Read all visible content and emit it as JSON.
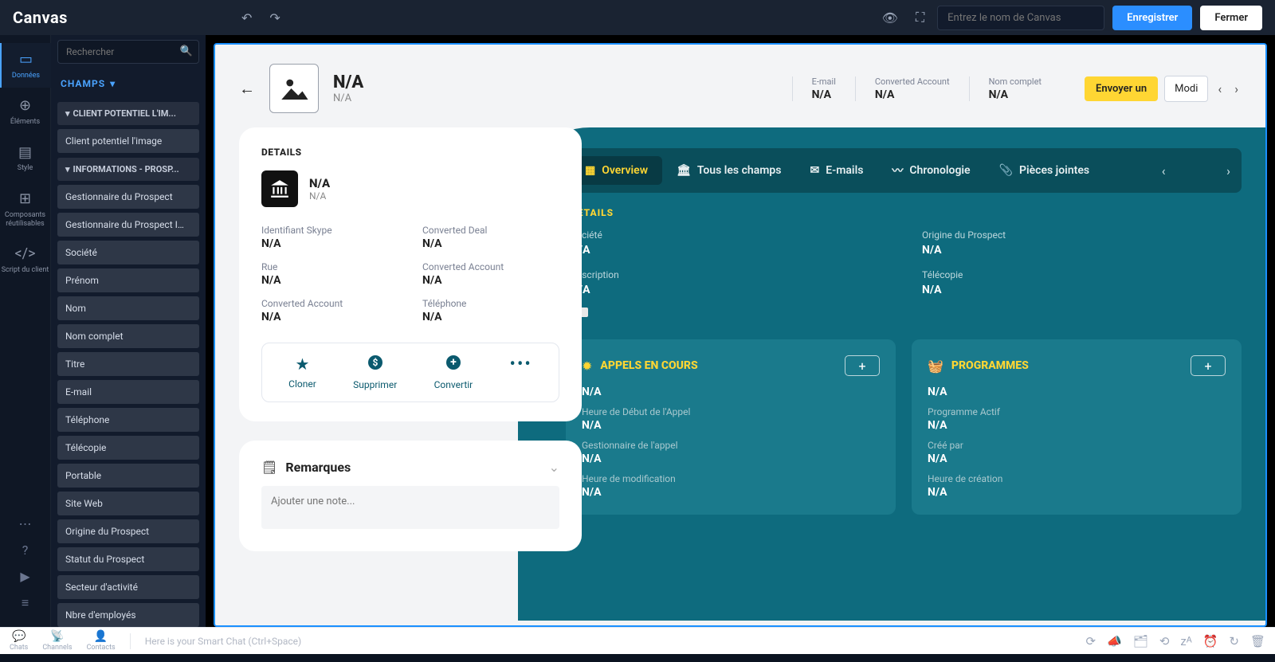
{
  "topbar": {
    "logo": "Canvas",
    "canvas_name_placeholder": "Entrez le nom de Canvas",
    "save": "Enregistrer",
    "close": "Fermer"
  },
  "rail": {
    "data": "Données",
    "elements": "Éléments",
    "style": "Style",
    "reusable": "Composants réutilisables",
    "script": "Script du client"
  },
  "sidebar": {
    "search_placeholder": "Rechercher",
    "panel_title": "CHAMPS",
    "group1": "CLIENT POTENTIEL L'IM...",
    "group1_items": [
      "Client potentiel l'image"
    ],
    "group2": "INFORMATIONS - PROSP...",
    "group2_items": [
      "Gestionnaire du Prospect",
      "Gestionnaire du Prospect Image",
      "Société",
      "Prénom",
      "Nom",
      "Nom complet",
      "Titre",
      "E-mail",
      "Téléphone",
      "Télécopie",
      "Portable",
      "Site Web",
      "Origine du Prospect",
      "Statut du Prospect",
      "Secteur d'activité",
      "Nbre d'employés"
    ]
  },
  "record": {
    "title": "N/A",
    "subtitle": "N/A",
    "header_fields": [
      {
        "label": "E-mail",
        "value": "N/A"
      },
      {
        "label": "Converted Account",
        "value": "N/A"
      },
      {
        "label": "Nom complet",
        "value": "N/A"
      }
    ],
    "send_button": "Envoyer un",
    "modify_button": "Modi",
    "details_title": "DETAILS",
    "manager_title": "N/A",
    "manager_sub": "N/A",
    "fields": [
      {
        "label": "Identifiant Skype",
        "value": "N/A"
      },
      {
        "label": "Converted Deal",
        "value": "N/A"
      },
      {
        "label": "Rue",
        "value": "N/A"
      },
      {
        "label": "Converted Account",
        "value": "N/A"
      },
      {
        "label": "Converted Account",
        "value": "N/A"
      },
      {
        "label": "Téléphone",
        "value": "N/A"
      }
    ],
    "actions": {
      "clone": "Cloner",
      "delete": "Supprimer",
      "convert": "Convertir"
    },
    "notes_title": "Remarques",
    "notes_placeholder": "Ajouter une note..."
  },
  "tabs": {
    "overview": "Overview",
    "allfields": "Tous les champs",
    "emails": "E-mails",
    "chronology": "Chronologie",
    "attachments": "Pièces jointes"
  },
  "teal": {
    "details_title": "DETAILS",
    "fields": [
      {
        "label": "Société",
        "value": "N/A"
      },
      {
        "label": "Origine du Prospect",
        "value": "N/A"
      },
      {
        "label": "Description",
        "value": "N/A"
      },
      {
        "label": "Télécopie",
        "value": "N/A"
      }
    ],
    "calls": {
      "title": "APPELS EN COURS",
      "main": "N/A",
      "rows": [
        {
          "label": "Heure de Début de l'Appel",
          "value": "N/A"
        },
        {
          "label": "Gestionnaire de l'appel",
          "value": "N/A"
        },
        {
          "label": "Heure de modification",
          "value": "N/A"
        }
      ]
    },
    "programs": {
      "title": "PROGRAMMES",
      "main": "N/A",
      "rows": [
        {
          "label": "Programme Actif",
          "value": "N/A"
        },
        {
          "label": "Créé par",
          "value": "N/A"
        },
        {
          "label": "Heure de création",
          "value": "N/A"
        }
      ]
    }
  },
  "bottombar": {
    "chats": "Chats",
    "channels": "Channels",
    "contacts": "Contacts",
    "hint": "Here is your Smart Chat (Ctrl+Space)"
  }
}
